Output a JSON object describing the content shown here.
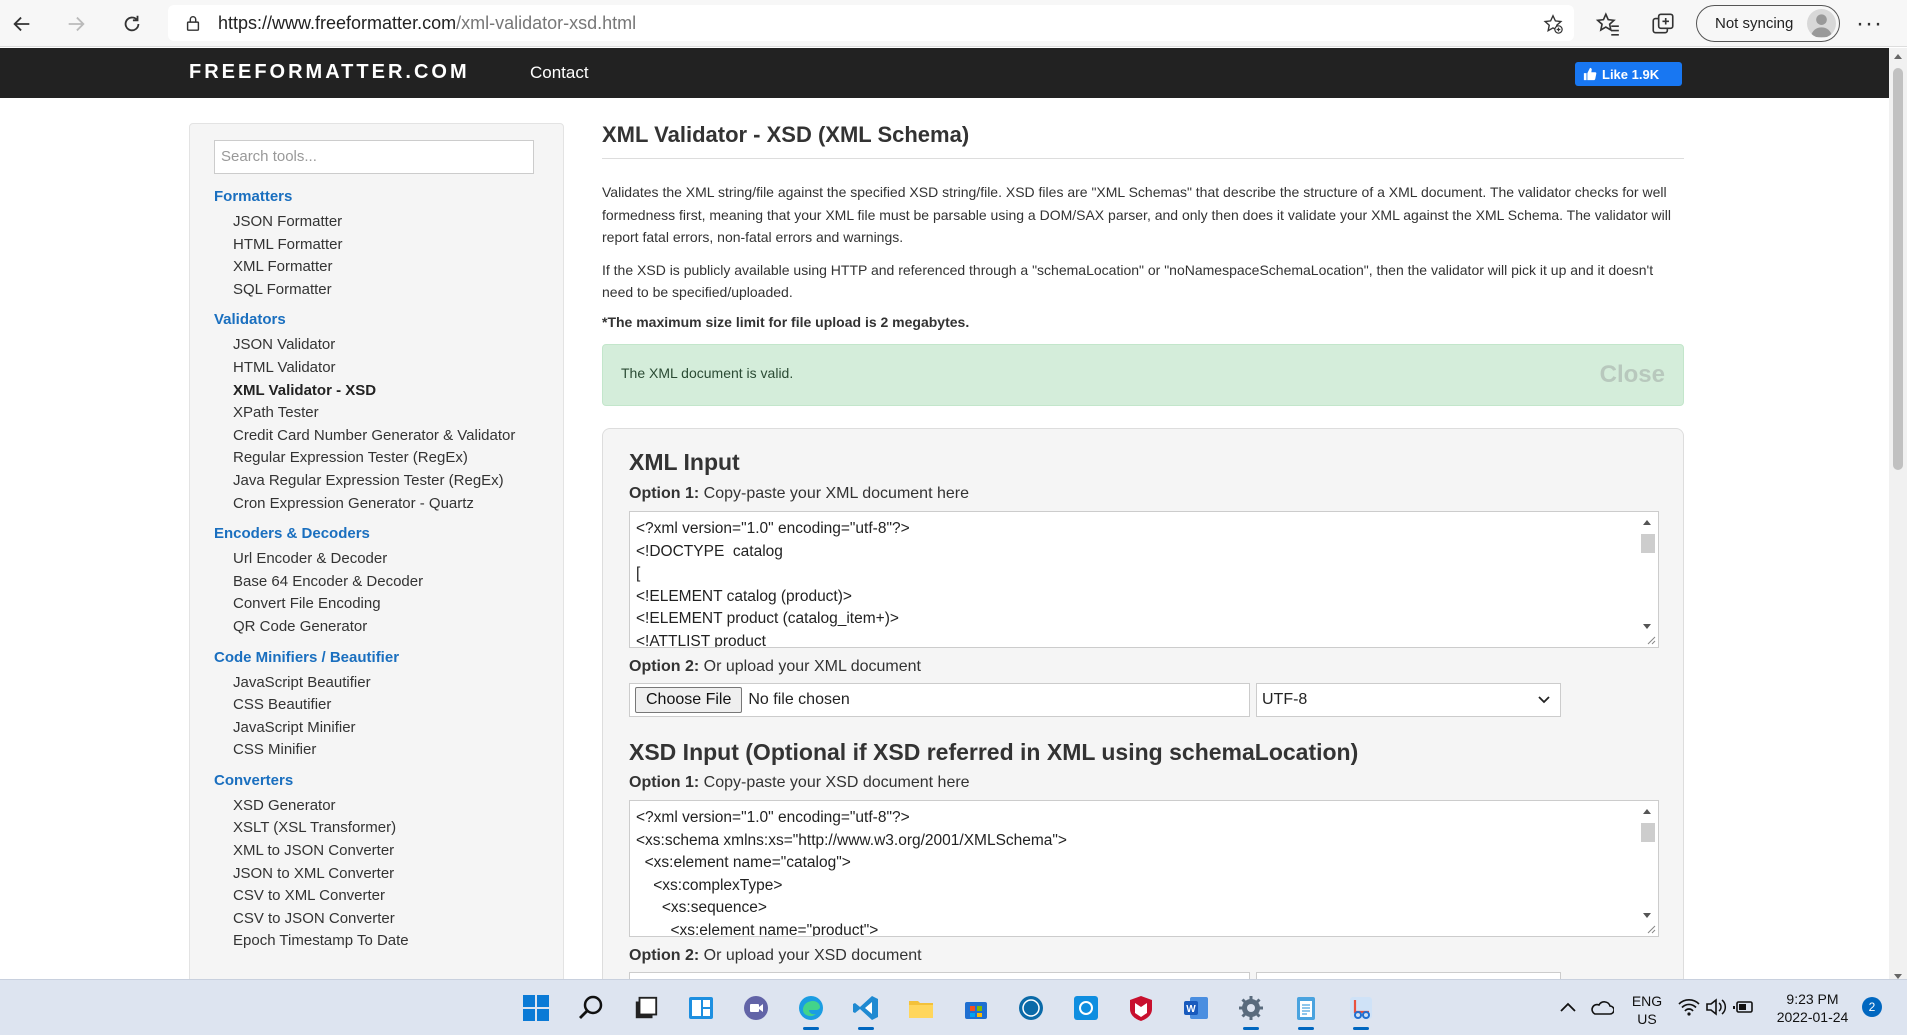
{
  "browser": {
    "url_domain": "https://www.freeformatter.com",
    "url_path": "/xml-validator-xsd.html",
    "sync_label": "Not syncing"
  },
  "site": {
    "brand": "FREEFORMATTER.COM",
    "nav_contact": "Contact",
    "fb_like": "Like 1.9K"
  },
  "sidebar": {
    "search_placeholder": "Search tools...",
    "sections": [
      {
        "title": "Formatters",
        "items": [
          "JSON Formatter",
          "HTML Formatter",
          "XML Formatter",
          "SQL Formatter"
        ]
      },
      {
        "title": "Validators",
        "items": [
          "JSON Validator",
          "HTML Validator",
          "XML Validator - XSD",
          "XPath Tester",
          "Credit Card Number Generator & Validator",
          "Regular Expression Tester (RegEx)",
          "Java Regular Expression Tester (RegEx)",
          "Cron Expression Generator - Quartz"
        ]
      },
      {
        "title": "Encoders & Decoders",
        "items": [
          "Url Encoder & Decoder",
          "Base 64 Encoder & Decoder",
          "Convert File Encoding",
          "QR Code Generator"
        ]
      },
      {
        "title": "Code Minifiers / Beautifier",
        "items": [
          "JavaScript Beautifier",
          "CSS Beautifier",
          "JavaScript Minifier",
          "CSS Minifier"
        ]
      },
      {
        "title": "Converters",
        "items": [
          "XSD Generator",
          "XSLT (XSL Transformer)",
          "XML to JSON Converter",
          "JSON to XML Converter",
          "CSV to XML Converter",
          "CSV to JSON Converter",
          "Epoch Timestamp To Date"
        ]
      }
    ]
  },
  "main": {
    "title": "XML Validator - XSD (XML Schema)",
    "desc1": "Validates the XML string/file against the specified XSD string/file. XSD files are \"XML Schemas\" that describe the structure of a XML document. The validator checks for well formedness first, meaning that your XML file must be parsable using a DOM/SAX parser, and only then does it validate your XML against the XML Schema. The validator will report fatal errors, non-fatal errors and warnings.",
    "desc2": "If the XSD is publicly available using HTTP and referenced through a \"schemaLocation\" or \"noNamespaceSchemaLocation\", then the validator will pick it up and it doesn't need to be specified/uploaded.",
    "note": "*The maximum size limit for file upload is 2 megabytes.",
    "alert_msg": "The XML document is valid.",
    "alert_close": "Close"
  },
  "xml_input": {
    "heading": "XML Input",
    "opt1_bold": "Option 1:",
    "opt1_text": " Copy-paste your XML document here",
    "code": "<?xml version=\"1.0\" encoding=\"utf-8\"?>\n<!DOCTYPE  catalog\n[\n<!ELEMENT catalog (product)>\n<!ELEMENT product (catalog_item+)>\n<!ATTLIST product",
    "opt2_bold": "Option 2:",
    "opt2_text": " Or upload your XML document",
    "file_button": "Choose File",
    "file_status": "No file chosen",
    "encoding": "UTF-8"
  },
  "xsd_input": {
    "heading": "XSD Input (Optional if XSD referred in XML using schemaLocation)",
    "opt1_bold": "Option 1:",
    "opt1_text": " Copy-paste your XSD document here",
    "code": "<?xml version=\"1.0\" encoding=\"utf-8\"?>\n<xs:schema xmlns:xs=\"http://www.w3.org/2001/XMLSchema\">\n  <xs:element name=\"catalog\">\n    <xs:complexType>\n      <xs:sequence>\n        <xs:element name=\"product\">",
    "opt2_bold": "Option 2:",
    "opt2_text": " Or upload your XSD document"
  },
  "taskbar": {
    "lang": "ENG",
    "region": "US",
    "time": "9:23 PM",
    "date": "2022-01-24",
    "notifications": "2"
  }
}
